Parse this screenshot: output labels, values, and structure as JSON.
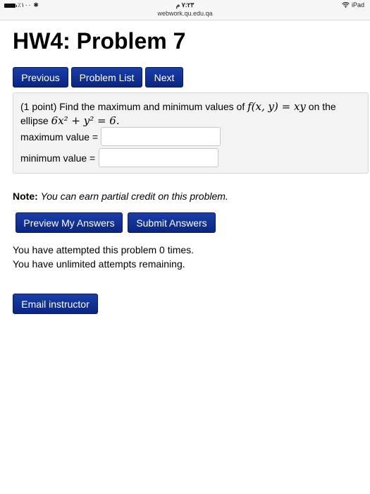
{
  "status_bar": {
    "battery": "٪١٠٠",
    "time": "٧:٢٣ م",
    "url": "webwork.qu.edu.qa",
    "device": "iPad"
  },
  "page_title": "HW4: Problem 7",
  "nav": {
    "previous": "Previous",
    "problem_list": "Problem List",
    "next": "Next"
  },
  "problem": {
    "intro": "(1 point) Find the maximum and minimum values of",
    "function": "f(x, y) = xy",
    "on_the": "on the",
    "ellipse_word": "ellipse",
    "ellipse_eq": "6x² + y² = 6.",
    "max_label": "maximum value =",
    "min_label": "minimum value =",
    "max_value": "",
    "min_value": ""
  },
  "note": {
    "label": "Note:",
    "text": "You can earn partial credit on this problem."
  },
  "actions": {
    "preview": "Preview My Answers",
    "submit": "Submit Answers"
  },
  "attempts": {
    "line1": "You have attempted this problem 0 times.",
    "line2": "You have unlimited attempts remaining."
  },
  "email": "Email instructor",
  "colors": {
    "button": "#0a2581",
    "problem_bg": "#f3f3f3"
  }
}
